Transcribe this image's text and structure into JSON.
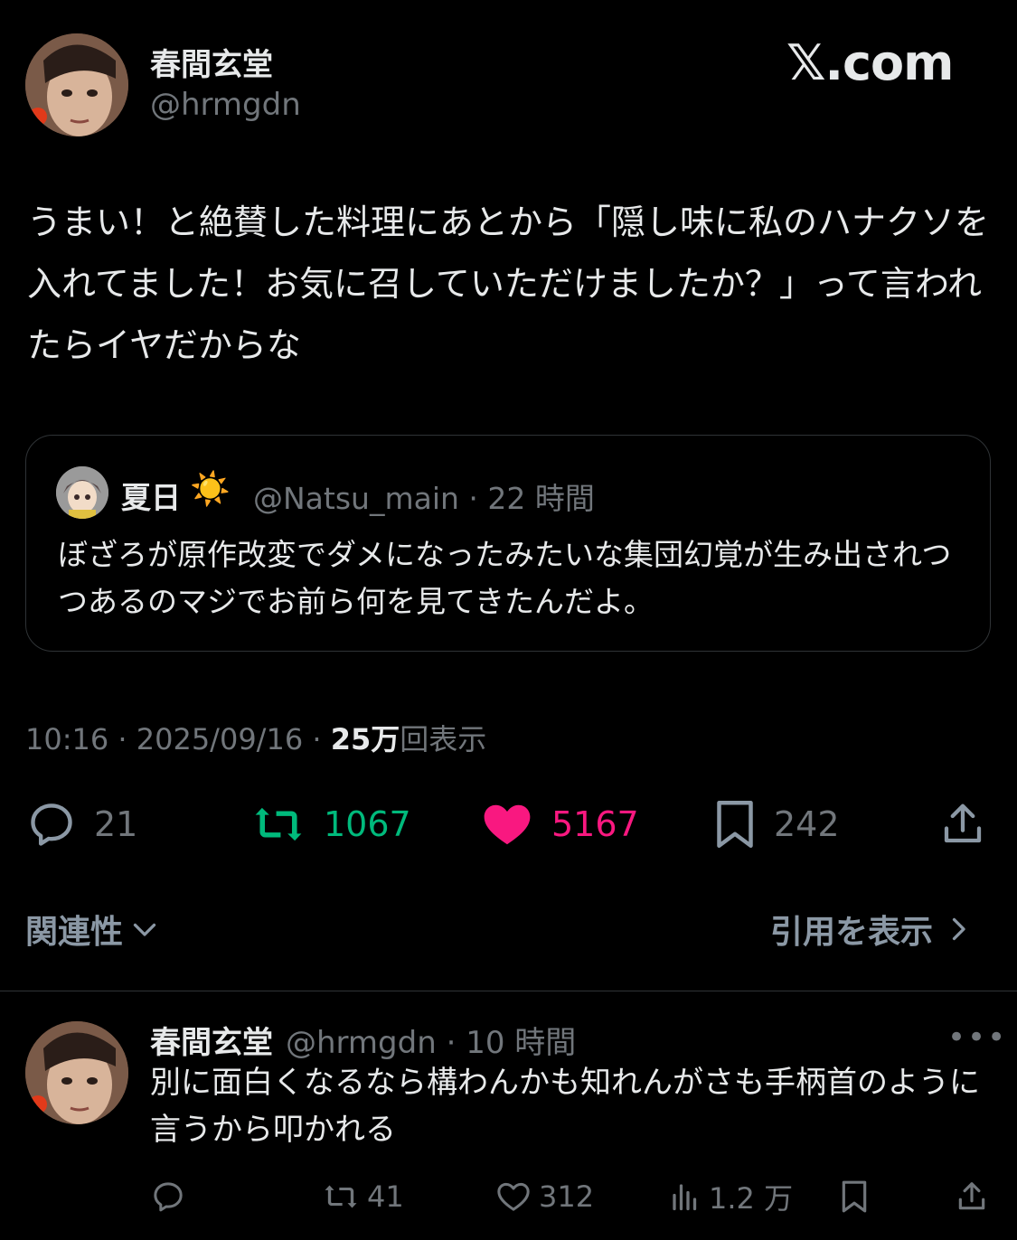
{
  "tweet": {
    "author_name": "春間玄堂",
    "author_handle": "@hrmgdn",
    "site_logo": "𝕏.com",
    "text": "うまい！と絶賛した料理にあとから「隠し味に私のハナクソを入れてました！お気に召していただけましたか？」って言われたらイヤだからな",
    "time": "10:16",
    "date": "2025/09/16",
    "views_count": "25万",
    "views_label": "回表示",
    "reply_count": "21",
    "retweet_count": "1067",
    "like_count": "5167",
    "bookmark_count": "242",
    "colors": {
      "retweet": "#00ba7c",
      "like": "#f91880",
      "muted": "#71767b"
    }
  },
  "quote": {
    "name": "夏日",
    "emoji": "☀️",
    "handle": "@Natsu_main",
    "time_ago": "22 時間",
    "text": "ぼざろが原作改変でダメになったみたいな集団幻覚が生み出されつつあるのマジでお前ら何を見てきたんだよ。"
  },
  "filters": {
    "relevance": "関連性",
    "show_quotes": "引用を表示"
  },
  "reply": {
    "name": "春間玄堂",
    "handle": "@hrmgdn",
    "time_ago": "10 時間",
    "text": "別に面白くなるなら構わんかも知れんがさも手柄首のように言うから叩かれる",
    "retweet_count": "41",
    "like_count": "312",
    "views_count": "1.2 万"
  },
  "icons": [
    "reply-icon",
    "retweet-icon",
    "heart-icon",
    "bookmark-icon",
    "share-icon",
    "views-icon",
    "more-icon",
    "chevron-down-icon",
    "chevron-right-icon",
    "sun-icon"
  ]
}
